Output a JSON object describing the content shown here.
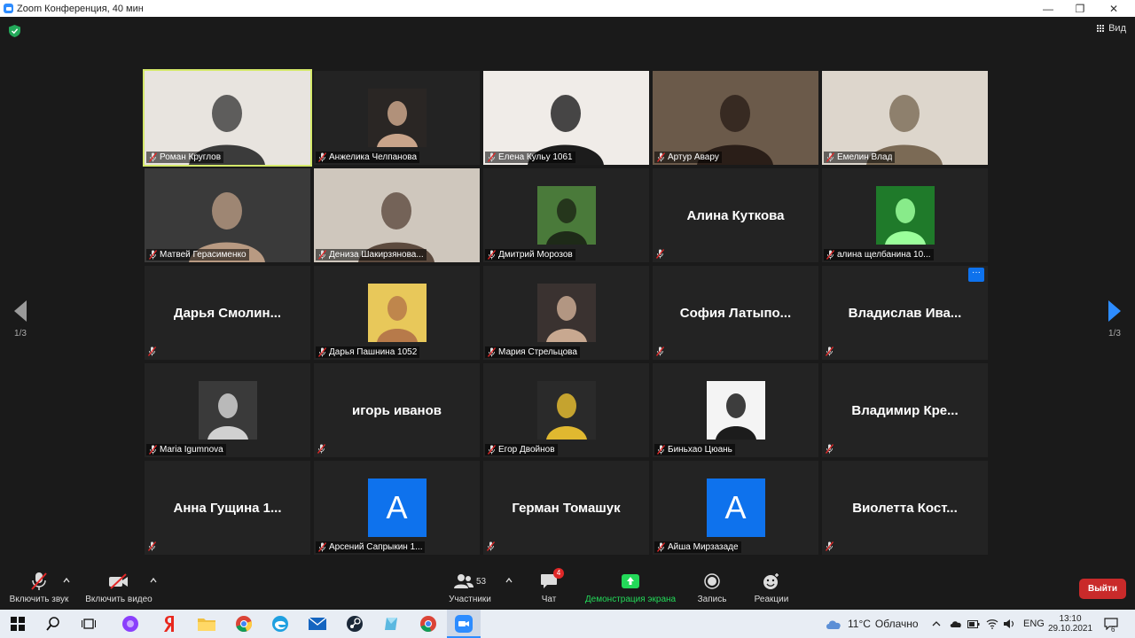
{
  "window": {
    "title": "Zoom Конференция, 40 мин",
    "minimize": "—",
    "maximize": "❐",
    "close": "✕"
  },
  "meeting": {
    "view_label": "Вид",
    "page_indicator_left": "1/3",
    "page_indicator_right": "1/3",
    "more_button": "···"
  },
  "colors": {
    "active_speaker_border": "#d4e86a",
    "avatar_blue": "#0e72ed",
    "leave_red": "#c92a2a",
    "share_green": "#23d959",
    "nav_arrow_blue": "#2d8cff"
  },
  "participants": [
    {
      "name": "Роман Круглов",
      "kind": "video",
      "active": true
    },
    {
      "name": "Анжелика Челпанова",
      "kind": "thumb"
    },
    {
      "name": "Елена Кульу 1061",
      "kind": "video"
    },
    {
      "name": "Артур Авару",
      "kind": "video"
    },
    {
      "name": "Емелин Влад",
      "kind": "video"
    },
    {
      "name": "Матвей Герасименко",
      "kind": "video"
    },
    {
      "name": "Дениза Шакирзянова...",
      "kind": "video"
    },
    {
      "name": "Дмитрий Морозов",
      "kind": "thumb"
    },
    {
      "name": "Алина Куткова",
      "kind": "name"
    },
    {
      "name": "алина щелбанина 10...",
      "kind": "thumb"
    },
    {
      "name": "Дарья Смолин...",
      "kind": "name"
    },
    {
      "name": "Дарья Пашнина 1052",
      "kind": "thumb"
    },
    {
      "name": "Мария Стрельцова",
      "kind": "thumb"
    },
    {
      "name": "София Латыпо...",
      "kind": "name"
    },
    {
      "name": "Владислав Ива...",
      "kind": "name",
      "more": true
    },
    {
      "name": "Maria Igumnova",
      "kind": "thumb"
    },
    {
      "name": "игорь иванов",
      "kind": "name"
    },
    {
      "name": "Егор Двойнов",
      "kind": "thumb"
    },
    {
      "name": "Биньхао Цюань",
      "kind": "thumb"
    },
    {
      "name": "Владимир Кре...",
      "kind": "name"
    },
    {
      "name": "Анна Гущина 1...",
      "kind": "name"
    },
    {
      "name": "Арсений Сапрыкин 1...",
      "kind": "avatar",
      "initial": "A"
    },
    {
      "name": "Герман Томашук",
      "kind": "name"
    },
    {
      "name": "Айша Мирзазаде",
      "kind": "avatar",
      "initial": "A"
    },
    {
      "name": "Виолетта Кост...",
      "kind": "name"
    }
  ],
  "toolbar": {
    "unmute_label": "Включить звук",
    "start_video_label": "Включить видео",
    "participants_label": "Участники",
    "participants_count": "53",
    "chat_label": "Чат",
    "chat_badge": "4",
    "share_label": "Демонстрация экрана",
    "record_label": "Запись",
    "reactions_label": "Реакции",
    "leave_label": "Выйти"
  },
  "taskbar": {
    "weather_temp": "11°C",
    "weather_text": "Облачно",
    "language": "ENG",
    "time": "13:10",
    "date": "29.10.2021",
    "notification_count": "6"
  }
}
